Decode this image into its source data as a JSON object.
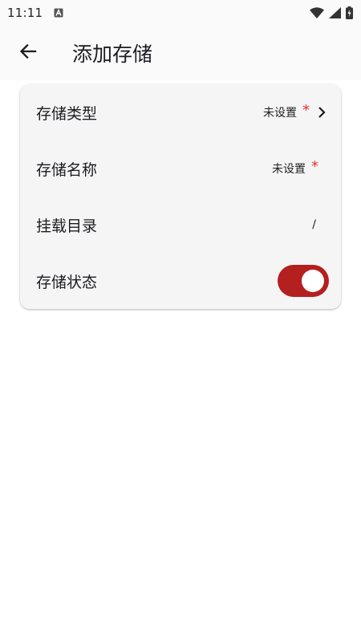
{
  "status_bar": {
    "time": "11:11",
    "notification_icon": "a-letter-icon",
    "icons": [
      "wifi-icon",
      "signal-icon",
      "battery-charging-icon"
    ]
  },
  "app_bar": {
    "back_icon": "arrow-back-icon",
    "title": "添加存储"
  },
  "form": {
    "rows": [
      {
        "label": "存储类型",
        "value": "未设置",
        "required": true,
        "has_chevron": true
      },
      {
        "label": "存储名称",
        "value": "未设置",
        "required": true,
        "has_chevron": false
      },
      {
        "label": "挂载目录",
        "value": "/",
        "required": false,
        "has_chevron": false
      },
      {
        "label": "存储状态",
        "toggle_on": true
      }
    ],
    "required_marker": "*"
  },
  "colors": {
    "accent": "#b3201f",
    "required": "#e0342f",
    "card_bg": "#f6f5f6",
    "app_bar_bg": "#fafafa"
  }
}
